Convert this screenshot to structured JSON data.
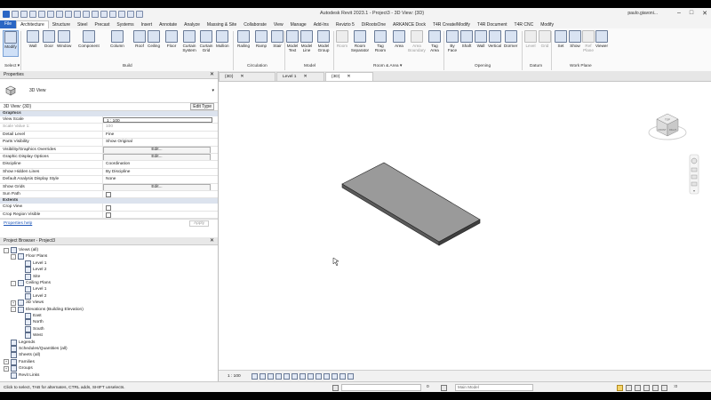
{
  "window": {
    "title": "Autodesk Revit 2023.1 - Project3 - 3D View: {3D}",
    "user": "paulo.giavoni..."
  },
  "ribbon_tabs": [
    "File",
    "Architecture",
    "Structure",
    "Steel",
    "Precast",
    "Systems",
    "Insert",
    "Annotate",
    "Analyze",
    "Massing & Site",
    "Collaborate",
    "View",
    "Manage",
    "Add-Ins",
    "Revizto 5",
    "DiRootsOne",
    "ARKANCE Dock",
    "T4R Create/Modify",
    "T4R Document",
    "T4R CNC",
    "Modify"
  ],
  "ribbon_buttons": {
    "modify": "Modify",
    "wall": "Wall",
    "door": "Door",
    "window": "Window",
    "component": "Component",
    "column": "Column",
    "roof": "Roof",
    "ceiling": "Ceiling",
    "floor": "Floor",
    "curtain_system": "Curtain System",
    "curtain_grid": "Curtain Grid",
    "mullion": "Mullion",
    "railing": "Railing",
    "ramp": "Ramp",
    "stair": "Stair",
    "model_text": "Model Text",
    "model_line": "Model Line",
    "model_group": "Model Group",
    "room": "Room",
    "room_separator": "Room Separator",
    "tag_room": "Tag Room",
    "area": "Area",
    "area_boundary": "Area Boundary",
    "tag_area": "Tag Area",
    "by_face": "By Face",
    "shaft": "Shaft",
    "wall_opening": "Wall",
    "vertical": "Vertical",
    "dormer": "Dormer",
    "level": "Level",
    "grid": "Grid",
    "set": "Set",
    "show": "Show",
    "ref_plane": "Ref Plane",
    "viewer": "Viewer"
  },
  "ribbon_groups": {
    "select": "Select",
    "build": "Build",
    "circulation": "Circulation",
    "model": "Model",
    "room_area": "Room & Area",
    "opening": "Opening",
    "datum": "Datum",
    "work_plane": "Work Plane"
  },
  "properties": {
    "title": "Properties",
    "type_name": "3D View",
    "instance_label": "3D View: {3D}",
    "edit_type": "Edit Type",
    "sections": {
      "graphics": "Graphics",
      "extents": "Extents"
    },
    "rows": [
      {
        "k": "View Scale",
        "v": "1 : 100",
        "style": "box"
      },
      {
        "k": "Scale Value    1:",
        "v": "100",
        "style": "dim"
      },
      {
        "k": "Detail Level",
        "v": "Fine",
        "style": ""
      },
      {
        "k": "Parts Visibility",
        "v": "Show Original",
        "style": ""
      },
      {
        "k": "Visibility/Graphics Overrides",
        "v": "Edit...",
        "style": "btn"
      },
      {
        "k": "Graphic Display Options",
        "v": "Edit...",
        "style": "btn"
      },
      {
        "k": "Discipline",
        "v": "Coordination",
        "style": ""
      },
      {
        "k": "Show Hidden Lines",
        "v": "By Discipline",
        "style": ""
      },
      {
        "k": "Default Analysis Display Style",
        "v": "None",
        "style": ""
      },
      {
        "k": "Show Grids",
        "v": "Edit...",
        "style": "btn"
      },
      {
        "k": "Sun Path",
        "v": "",
        "style": "chk"
      }
    ],
    "extents_rows": [
      {
        "k": "Crop View",
        "v": "",
        "style": "chk"
      },
      {
        "k": "Crop Region Visible",
        "v": "",
        "style": "chk"
      }
    ],
    "help": "Properties help",
    "apply": "Apply"
  },
  "browser": {
    "title": "Project Browser - Project3",
    "items": [
      {
        "t": "Views (all)",
        "lvl": 0,
        "tog": "-"
      },
      {
        "t": "Floor Plans",
        "lvl": 1,
        "tog": "-"
      },
      {
        "t": "Level 1",
        "lvl": 2,
        "tog": ""
      },
      {
        "t": "Level 2",
        "lvl": 2,
        "tog": ""
      },
      {
        "t": "Site",
        "lvl": 2,
        "tog": ""
      },
      {
        "t": "Ceiling Plans",
        "lvl": 1,
        "tog": "-"
      },
      {
        "t": "Level 1",
        "lvl": 2,
        "tog": ""
      },
      {
        "t": "Level 2",
        "lvl": 2,
        "tog": ""
      },
      {
        "t": "3D Views",
        "lvl": 1,
        "tog": "+"
      },
      {
        "t": "Elevations (Building Elevation)",
        "lvl": 1,
        "tog": "-"
      },
      {
        "t": "East",
        "lvl": 2,
        "tog": ""
      },
      {
        "t": "North",
        "lvl": 2,
        "tog": ""
      },
      {
        "t": "South",
        "lvl": 2,
        "tog": ""
      },
      {
        "t": "West",
        "lvl": 2,
        "tog": ""
      },
      {
        "t": "Legends",
        "lvl": 0,
        "tog": ""
      },
      {
        "t": "Schedules/Quantities (all)",
        "lvl": 0,
        "tog": ""
      },
      {
        "t": "Sheets (all)",
        "lvl": 0,
        "tog": ""
      },
      {
        "t": "Families",
        "lvl": 0,
        "tog": "+"
      },
      {
        "t": "Groups",
        "lvl": 0,
        "tog": "+"
      },
      {
        "t": "Revit Links",
        "lvl": 0,
        "tog": ""
      }
    ]
  },
  "view_tabs": [
    {
      "label": "{3D}",
      "active": false
    },
    {
      "label": "Level 1",
      "active": false
    },
    {
      "label": "{3D}",
      "active": true
    }
  ],
  "view_scale": "1 : 100",
  "viewcube_faces": {
    "top": "TOP",
    "front": "FRONT",
    "right": "RIGHT"
  },
  "status": {
    "message": "Click to select, TAB for alternates, CTRL adds, SHIFT unselects.",
    "zero": "0",
    "workset": ":0",
    "model": "Main Model",
    "filter": "0"
  }
}
